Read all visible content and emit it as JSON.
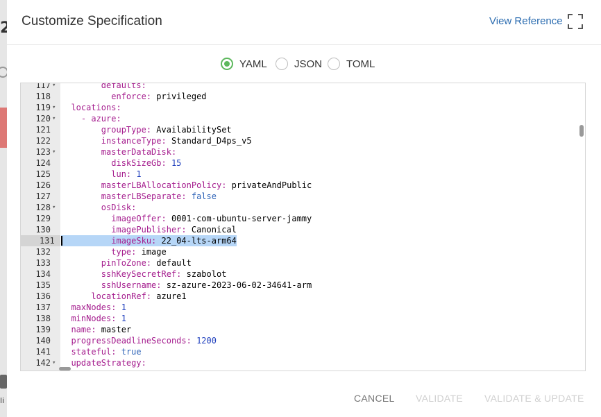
{
  "background": {
    "digit": "2",
    "text": "li"
  },
  "dialog": {
    "title": "Customize Specification",
    "view_reference": "View Reference",
    "expand_icon": "fullscreen-icon"
  },
  "formats": {
    "selected": "YAML",
    "options": [
      "YAML",
      "JSON",
      "TOML"
    ]
  },
  "editor": {
    "active_line": 131,
    "lines": [
      {
        "n": "117",
        "fold": true,
        "code": [
          [
            "k",
            "        defaults:"
          ]
        ]
      },
      {
        "n": "118",
        "fold": false,
        "code": [
          [
            "k",
            "          enforce: "
          ],
          [
            "v",
            "privileged"
          ]
        ]
      },
      {
        "n": "119",
        "fold": true,
        "code": [
          [
            "k",
            "  locations:"
          ]
        ]
      },
      {
        "n": "120",
        "fold": true,
        "code": [
          [
            "k",
            "    - azure:"
          ]
        ]
      },
      {
        "n": "121",
        "fold": false,
        "code": [
          [
            "k",
            "        groupType: "
          ],
          [
            "v",
            "AvailabilitySet"
          ]
        ]
      },
      {
        "n": "122",
        "fold": false,
        "code": [
          [
            "k",
            "        instanceType: "
          ],
          [
            "v",
            "Standard_D4ps_v5"
          ]
        ]
      },
      {
        "n": "123",
        "fold": true,
        "code": [
          [
            "k",
            "        masterDataDisk:"
          ]
        ]
      },
      {
        "n": "124",
        "fold": false,
        "code": [
          [
            "k",
            "          diskSizeGb: "
          ],
          [
            "n",
            "15"
          ]
        ]
      },
      {
        "n": "125",
        "fold": false,
        "code": [
          [
            "k",
            "          lun: "
          ],
          [
            "n",
            "1"
          ]
        ]
      },
      {
        "n": "126",
        "fold": false,
        "code": [
          [
            "k",
            "        masterLBAllocationPolicy: "
          ],
          [
            "v",
            "privateAndPublic"
          ]
        ]
      },
      {
        "n": "127",
        "fold": false,
        "code": [
          [
            "k",
            "        masterLBSeparate: "
          ],
          [
            "b",
            "false"
          ]
        ]
      },
      {
        "n": "128",
        "fold": true,
        "code": [
          [
            "k",
            "        osDisk:"
          ]
        ]
      },
      {
        "n": "129",
        "fold": false,
        "code": [
          [
            "k",
            "          imageOffer: "
          ],
          [
            "v",
            "0001-com-ubuntu-server-jammy"
          ]
        ]
      },
      {
        "n": "130",
        "fold": false,
        "code": [
          [
            "k",
            "          imagePublisher: "
          ],
          [
            "v",
            "Canonical"
          ]
        ]
      },
      {
        "n": "131",
        "fold": false,
        "code": [
          [
            "k",
            "          imageSku: "
          ],
          [
            "v",
            "22_04-lts-arm64"
          ]
        ]
      },
      {
        "n": "132",
        "fold": false,
        "code": [
          [
            "k",
            "          type: "
          ],
          [
            "v",
            "image"
          ]
        ]
      },
      {
        "n": "133",
        "fold": false,
        "code": [
          [
            "k",
            "        pinToZone: "
          ],
          [
            "v",
            "default"
          ]
        ]
      },
      {
        "n": "134",
        "fold": false,
        "code": [
          [
            "k",
            "        sshKeySecretRef: "
          ],
          [
            "v",
            "szabolot"
          ]
        ]
      },
      {
        "n": "135",
        "fold": false,
        "code": [
          [
            "k",
            "        sshUsername: "
          ],
          [
            "v",
            "sz-azure-2023-06-02-34641-arm"
          ]
        ]
      },
      {
        "n": "136",
        "fold": false,
        "code": [
          [
            "k",
            "      locationRef: "
          ],
          [
            "v",
            "azure1"
          ]
        ]
      },
      {
        "n": "137",
        "fold": false,
        "code": [
          [
            "k",
            "  maxNodes: "
          ],
          [
            "n",
            "1"
          ]
        ]
      },
      {
        "n": "138",
        "fold": false,
        "code": [
          [
            "k",
            "  minNodes: "
          ],
          [
            "n",
            "1"
          ]
        ]
      },
      {
        "n": "139",
        "fold": false,
        "code": [
          [
            "k",
            "  name: "
          ],
          [
            "v",
            "master"
          ]
        ]
      },
      {
        "n": "140",
        "fold": false,
        "code": [
          [
            "k",
            "  progressDeadlineSeconds: "
          ],
          [
            "n",
            "1200"
          ]
        ]
      },
      {
        "n": "141",
        "fold": false,
        "code": [
          [
            "k",
            "  stateful: "
          ],
          [
            "b",
            "true"
          ]
        ]
      },
      {
        "n": "142",
        "fold": true,
        "code": [
          [
            "k",
            "  updateStrategy:"
          ]
        ]
      }
    ]
  },
  "footer": {
    "cancel": "CANCEL",
    "validate": "VALIDATE",
    "validate_update": "VALIDATE & UPDATE"
  }
}
